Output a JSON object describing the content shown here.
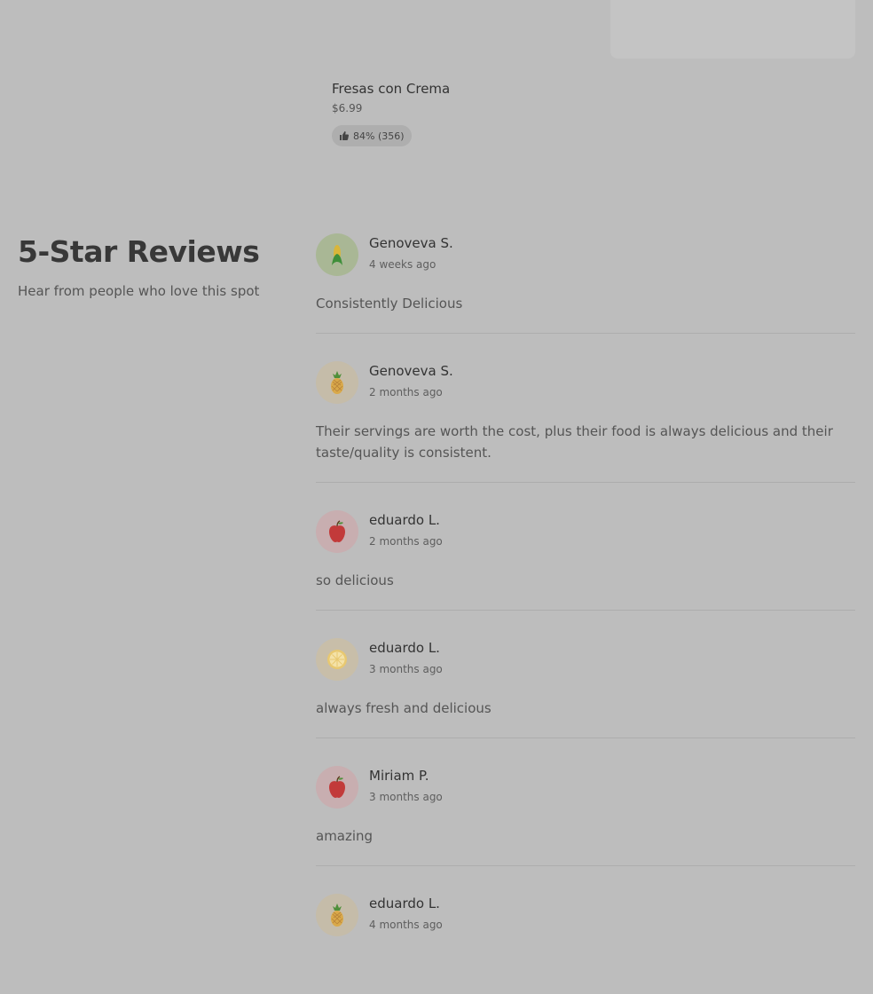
{
  "featured_item": {
    "name": "Fresas con Crema",
    "price": "$6.99",
    "rating": "84% (356)",
    "rating_icon": "thumbs-up-icon"
  },
  "reviews_section": {
    "title": "5-Star Reviews",
    "subtitle": "Hear from people who love this spot"
  },
  "reviews": [
    {
      "name": "Genoveva S.",
      "date": "4 weeks ago",
      "text": "Consistently Delicious",
      "avatar_icon": "corn-icon",
      "avatar_bg": "#a9b795"
    },
    {
      "name": "Genoveva S.",
      "date": "2 months ago",
      "text": "Their servings are worth the cost, plus their food is always delicious and their taste/quality is consistent.",
      "avatar_icon": "pineapple-icon",
      "avatar_bg": "#c5bca9"
    },
    {
      "name": "eduardo L.",
      "date": "2 months ago",
      "text": "so delicious",
      "avatar_icon": "apple-icon",
      "avatar_bg": "#c8aeb0"
    },
    {
      "name": "eduardo L.",
      "date": "3 months ago",
      "text": "always fresh and delicious",
      "avatar_icon": "lemon-slice-icon",
      "avatar_bg": "#c8bea9"
    },
    {
      "name": "Miriam P.",
      "date": "3 months ago",
      "text": "amazing",
      "avatar_icon": "apple-icon",
      "avatar_bg": "#c8aeb0"
    },
    {
      "name": "eduardo L.",
      "date": "4 months ago",
      "text": "",
      "avatar_icon": "pineapple-icon",
      "avatar_bg": "#c5bca9"
    }
  ]
}
